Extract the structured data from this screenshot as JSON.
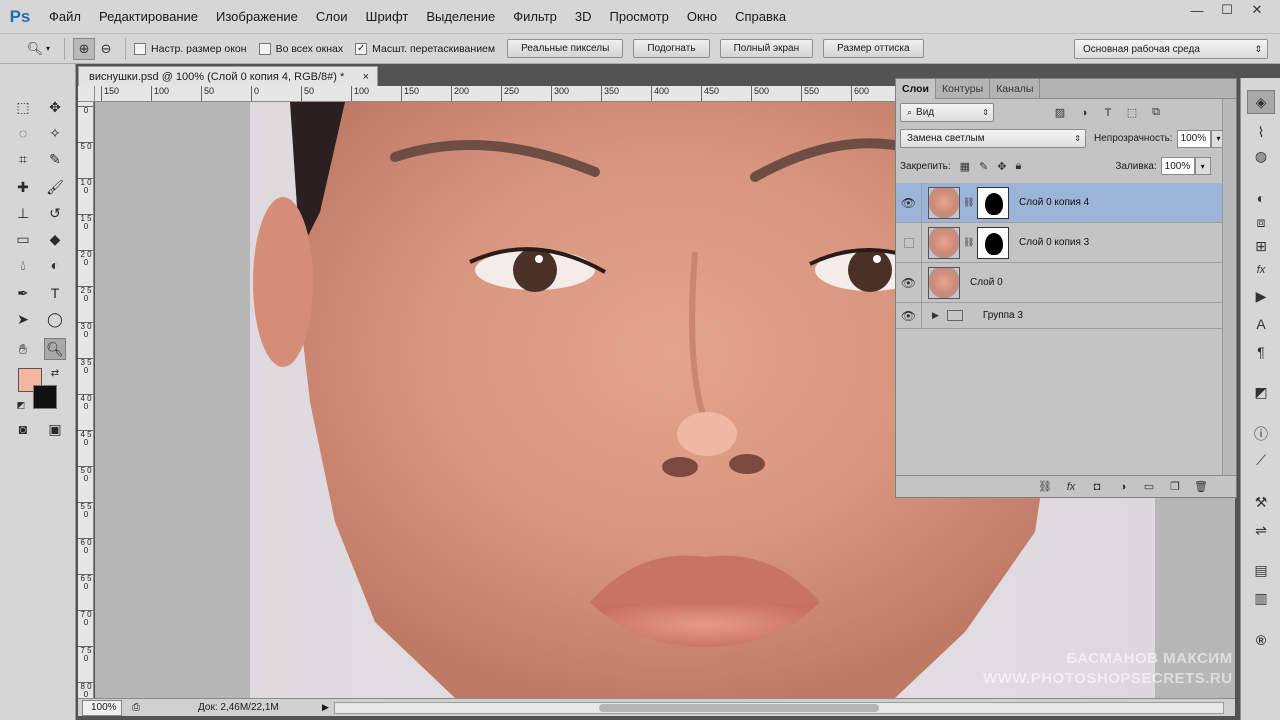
{
  "app": {
    "logo": "Ps"
  },
  "menu": [
    "Файл",
    "Редактирование",
    "Изображение",
    "Слои",
    "Шрифт",
    "Выделение",
    "Фильтр",
    "3D",
    "Просмотр",
    "Окно",
    "Справка"
  ],
  "window_controls": {
    "minimize": "—",
    "maximize": "☐",
    "close": "✕"
  },
  "options": {
    "resize_windows": {
      "label": "Настр. размер окон",
      "checked": false
    },
    "all_windows": {
      "label": "Во всех окнах",
      "checked": false
    },
    "scrubby_zoom": {
      "label": "Масшт. перетаскиванием",
      "checked": true
    },
    "actual_pixels": "Реальные пикселы",
    "fit_screen": "Подогнать",
    "full_screen": "Полный экран",
    "print_size": "Размер оттиска",
    "workspace": "Основная рабочая среда"
  },
  "document": {
    "tab_title": "виснушки.psd @ 100% (Слой 0 копия 4, RGB/8#) *",
    "close": "×"
  },
  "ruler": {
    "h_labels": [
      "150",
      "100",
      "50",
      "0",
      "50",
      "100",
      "150",
      "200",
      "250",
      "300",
      "350",
      "400",
      "450",
      "500",
      "550",
      "600"
    ],
    "v_labels": [
      "0",
      "5 0",
      "1 0 0",
      "1 5 0",
      "2 0 0",
      "2 5 0",
      "3 0 0",
      "3 5 0",
      "4 0 0",
      "4 5 0",
      "5 0 0",
      "5 5 0",
      "6 0 0",
      "6 5 0",
      "7 0 0",
      "7 5 0",
      "8 0 0"
    ]
  },
  "watermark": {
    "line1": "БАСМАНОВ МАКСИМ",
    "line2": "WWW.PHOTOSHOPSECRETS.RU"
  },
  "layers_panel": {
    "tabs": [
      "Слои",
      "Контуры",
      "Каналы"
    ],
    "filter_kind": "Вид",
    "blend_mode": "Замена светлым",
    "opacity_label": "Непрозрачность:",
    "opacity_value": "100%",
    "lock_label": "Закрепить:",
    "fill_label": "Заливка:",
    "fill_value": "100%",
    "layers": [
      {
        "name": "Слой 0 копия 4",
        "visible": true,
        "selected": true,
        "has_mask": true
      },
      {
        "name": "Слой 0 копия 3",
        "visible": false,
        "selected": false,
        "has_mask": true
      },
      {
        "name": "Слой 0",
        "visible": true,
        "selected": false,
        "has_mask": false
      },
      {
        "name": "Группа 3",
        "visible": true,
        "selected": false,
        "is_group": true
      }
    ]
  },
  "status": {
    "zoom": "100%",
    "doc_size": "Док: 2,46M/22,1M"
  }
}
